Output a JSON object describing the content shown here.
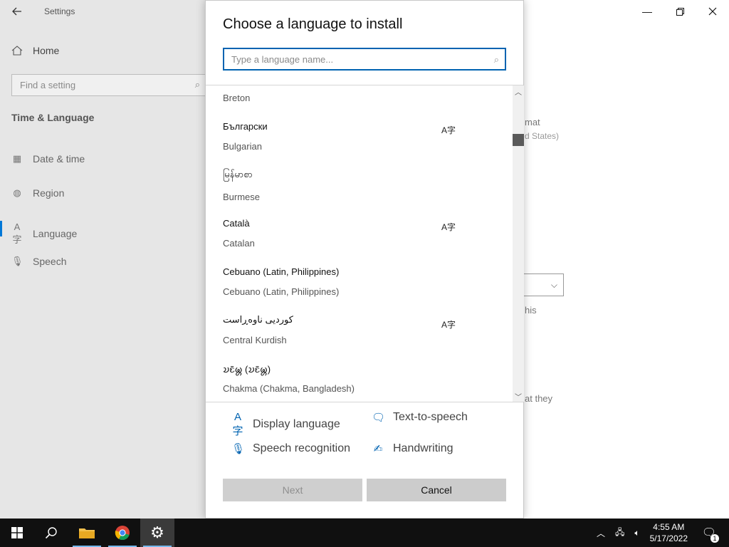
{
  "settings": {
    "window_title": "Settings",
    "home_label": "Home",
    "search_placeholder": "Find a setting",
    "section_title": "Time & Language",
    "nav": [
      {
        "label": "Date & time",
        "icon": "calendar-clock-icon"
      },
      {
        "label": "Region",
        "icon": "globe-icon"
      },
      {
        "label": "Language",
        "icon": "language-icon"
      },
      {
        "label": "Speech",
        "icon": "microphone-icon"
      }
    ],
    "background_snippets": {
      "format_tail": "mat",
      "region_tail": "d States)",
      "this_tail": "his",
      "they_tail": "at they"
    }
  },
  "dialog": {
    "title": "Choose a language to install",
    "search_placeholder": "Type a language name...",
    "languages": [
      {
        "native": "",
        "english": "Breton",
        "display_pack": false
      },
      {
        "native": "Български",
        "english": "Bulgarian",
        "display_pack": true
      },
      {
        "native": "မြန်မာစာ",
        "english": "Burmese",
        "display_pack": false
      },
      {
        "native": "Català",
        "english": "Catalan",
        "display_pack": true
      },
      {
        "native": "Cebuano (Latin, Philippines)",
        "english": "Cebuano (Latin, Philippines)",
        "display_pack": false
      },
      {
        "native": "کوردیی ناوەڕاست",
        "english": "Central Kurdish",
        "display_pack": true
      },
      {
        "native": "𑄌𑄋𑄴𑄟𑄳𑄦 (𑄌𑄋𑄴𑄟𑄳𑄦)",
        "english": "Chakma (Chakma, Bangladesh)",
        "display_pack": false
      }
    ],
    "features": {
      "display_language": "Display language",
      "text_to_speech": "Text-to-speech",
      "speech_recognition": "Speech recognition",
      "handwriting": "Handwriting"
    },
    "next_label": "Next",
    "cancel_label": "Cancel"
  },
  "taskbar": {
    "time": "4:55 AM",
    "date": "5/17/2022",
    "notification_count": "1"
  },
  "colors": {
    "accent": "#0078d7",
    "feature_icon": "#0063b1",
    "taskbar": "#101010"
  }
}
